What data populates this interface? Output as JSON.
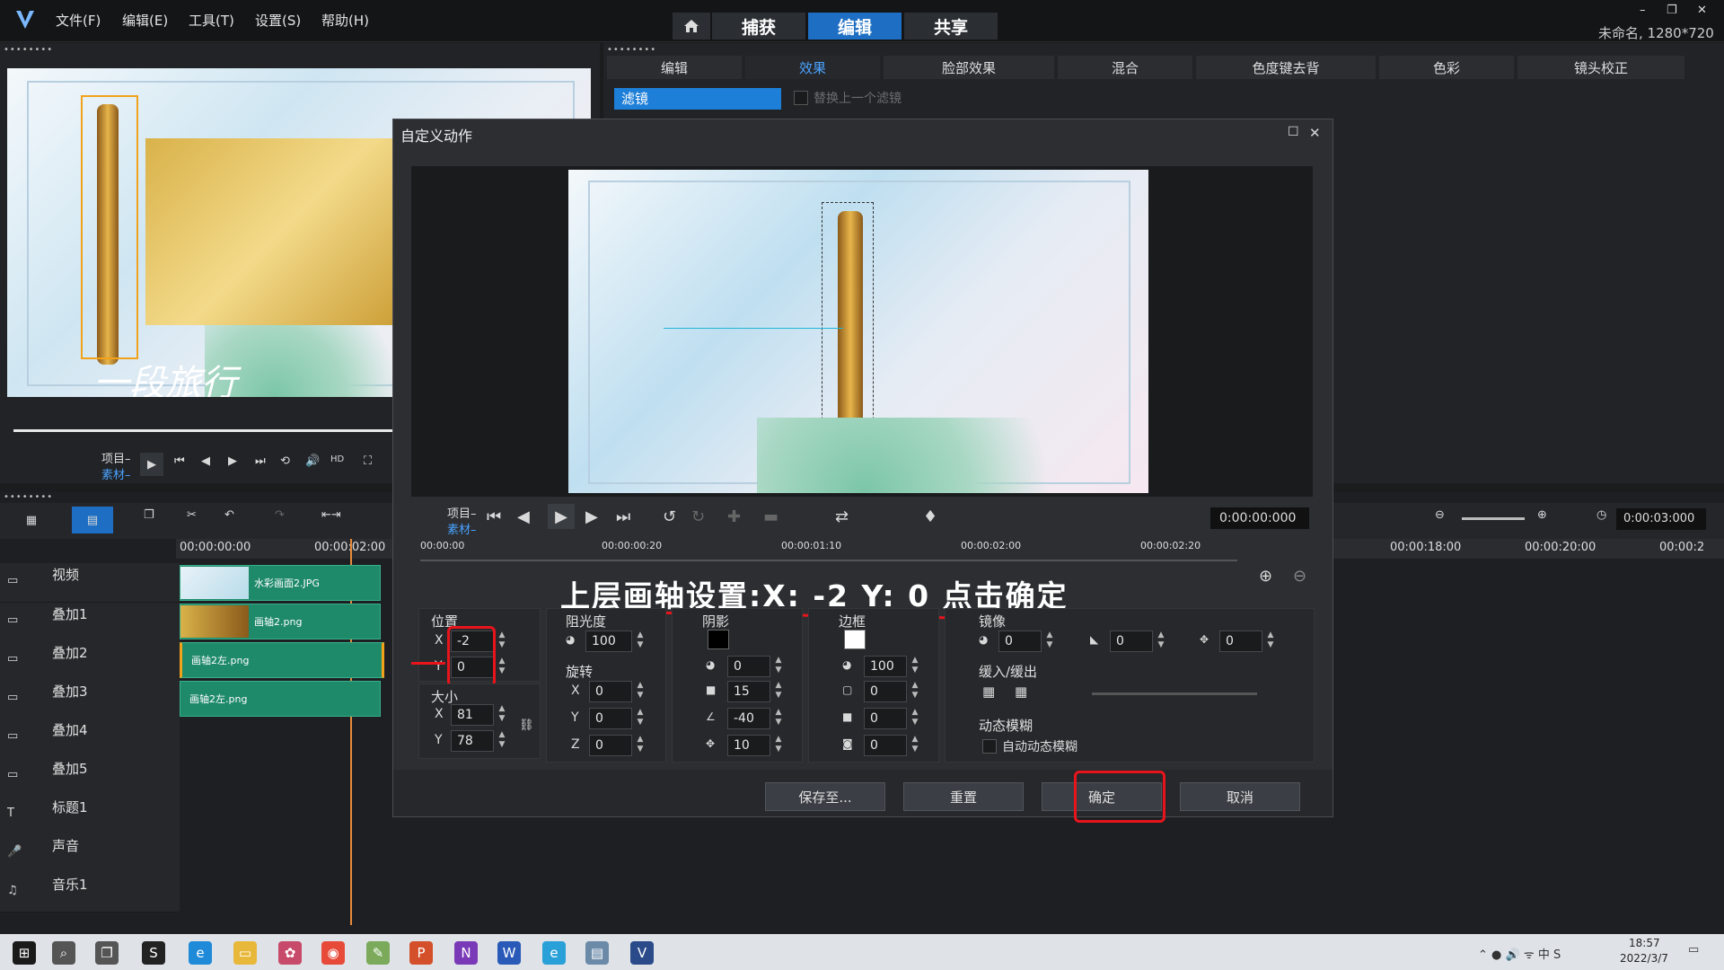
{
  "menu": {
    "file": "文件(F)",
    "edit": "编辑(E)",
    "tools": "工具(T)",
    "settings": "设置(S)",
    "help": "帮助(H)"
  },
  "modes": {
    "capture": "捕获",
    "edit": "编辑",
    "share": "共享"
  },
  "project_info": "未命名, 1280*720",
  "panel_dots": "••••••••",
  "fx_tabs": [
    "编辑",
    "效果",
    "脸部效果",
    "混合",
    "色度键去背",
    "色彩",
    "镜头校正"
  ],
  "filter": {
    "label": "滤镜",
    "replace_prev": "替换上一个滤镜"
  },
  "preview": {
    "project_label": "项目–",
    "clip_label": "素材–",
    "title_overlay": "一段旅行"
  },
  "timeline": {
    "ruler": [
      "00:00:00:00",
      "00:00:02:00"
    ],
    "ruler_right": [
      "00:00:18:00",
      "00:00:20:00",
      "00:00:2"
    ],
    "timecode": "0:00:03:000",
    "tracks": [
      {
        "name": "视频"
      },
      {
        "name": "叠加1"
      },
      {
        "name": "叠加2"
      },
      {
        "name": "叠加3"
      },
      {
        "name": "叠加4"
      },
      {
        "name": "叠加5"
      },
      {
        "name": "标题1"
      },
      {
        "name": "声音"
      },
      {
        "name": "音乐1"
      }
    ],
    "clips": [
      "水彩画面2.JPG",
      "画轴2.png",
      "画轴2左.png",
      "画轴2左.png"
    ]
  },
  "dialog": {
    "title": "自定义动作",
    "project_label": "项目–",
    "clip_label": "素材–",
    "timecode": "0:00:00:000",
    "ruler": [
      "00:00:00",
      "00:00:00:20",
      "00:00:01:10",
      "00:00:02:00",
      "00:00:02:20"
    ],
    "annotation": "上层画轴设置:X: -2 Y: 0 点击确定",
    "position": {
      "label": "位置",
      "x_label": "X",
      "y_label": "Y",
      "x": "-2",
      "y": "0"
    },
    "size": {
      "label": "大小",
      "x_label": "X",
      "y_label": "Y",
      "x": "81",
      "y": "78"
    },
    "opacity": {
      "label": "阻光度",
      "value": "100"
    },
    "rotation": {
      "label": "旋转",
      "x_label": "X",
      "y_label": "Y",
      "z_label": "Z",
      "x": "0",
      "y": "0",
      "z": "0"
    },
    "shadow": {
      "label": "阴影",
      "v1": "0",
      "v2": "15",
      "v3": "-40",
      "v4": "10"
    },
    "border": {
      "label": "边框",
      "v1": "100",
      "v2": "0",
      "v3": "0",
      "v4": "0"
    },
    "mirror": {
      "label": "镜像",
      "v1": "0",
      "v2": "0",
      "v3": "0"
    },
    "ease": {
      "label": "缓入/缓出"
    },
    "motion_blur": {
      "label": "动态模糊",
      "auto": "自动动态模糊"
    },
    "buttons": {
      "save": "保存至...",
      "reset": "重置",
      "ok": "确定",
      "cancel": "取消"
    }
  },
  "taskbar": {
    "time": "18:57",
    "date": "2022/3/7"
  },
  "colors": {
    "accent": "#1e6fc3",
    "annotation": "#e8141c",
    "clip": "#1f8a6a"
  }
}
